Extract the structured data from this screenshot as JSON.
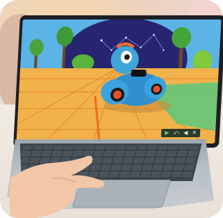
{
  "scene": {
    "description_icons": [
      "play-icon",
      "step-icon",
      "sound-icon",
      "close-icon"
    ]
  },
  "controls": {
    "play": "▶",
    "step": "⤺",
    "sound": "◀",
    "close": "✕"
  },
  "colors": {
    "floor": "#f2b24a",
    "sky": "#2a2b7a",
    "robot": "#3fa5d9",
    "wheel": "#e0552f"
  }
}
